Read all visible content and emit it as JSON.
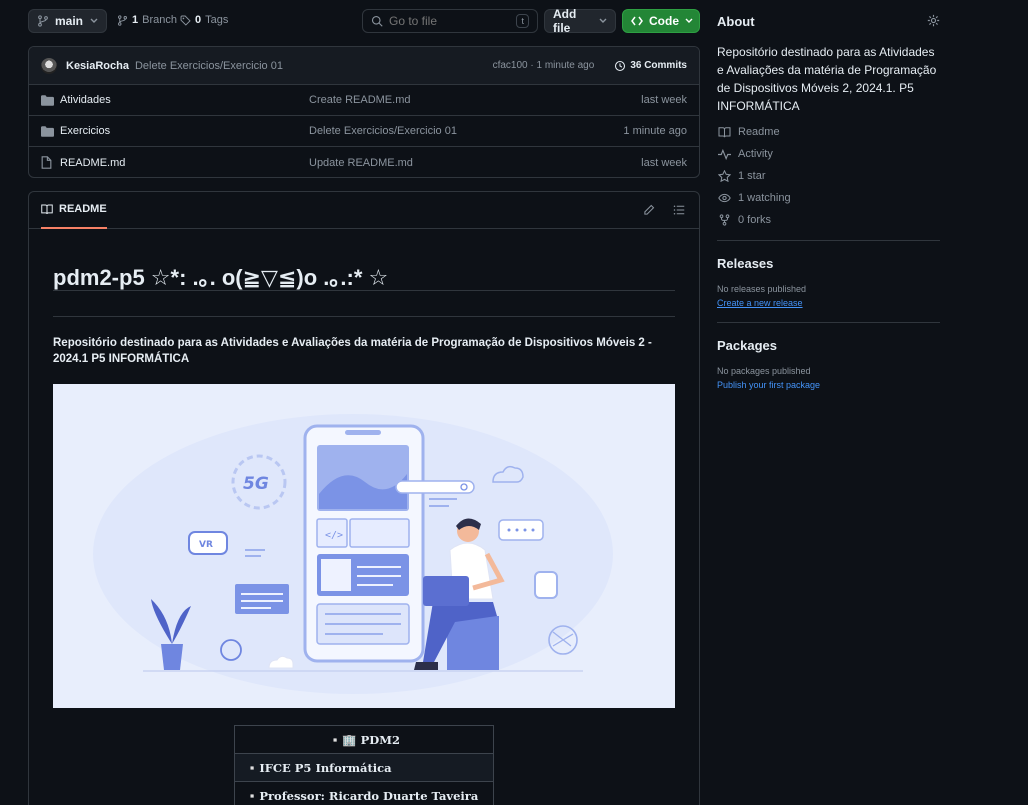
{
  "toolbar": {
    "branch": "main",
    "branch_count": "1",
    "branch_label": "Branch",
    "tag_count": "0",
    "tag_label": "Tags",
    "search_placeholder": "Go to file",
    "search_kbd": "t",
    "add_file": "Add file",
    "code": "Code"
  },
  "latest_commit": {
    "author": "KesiaRocha",
    "message": "Delete Exercicios/Exercicio 01",
    "hash_time": "cfac100 · 1 minute ago",
    "commits": "36 Commits"
  },
  "files": [
    {
      "name": "Atividades",
      "type": "folder",
      "message": "Create README.md",
      "date": "last week"
    },
    {
      "name": "Exercicios",
      "type": "folder",
      "message": "Delete Exercicios/Exercicio 01",
      "date": "1 minute ago"
    },
    {
      "name": "README.md",
      "type": "file",
      "message": "Update README.md",
      "date": "last week"
    }
  ],
  "readme": {
    "tab": "README",
    "title": "pdm2-p5 ☆*: .｡. o(≧▽≦)o .｡.:* ☆",
    "description": "Repositório destinado para as Atividades e Avaliações da matéria de Programação de Dispositivos Móveis 2 - 2024.1 P5 INFORMÁTICA",
    "banner_badge": "5G",
    "banner_vr": "VR",
    "table": {
      "header": "▫️🏢 PDM2",
      "rows": [
        "▫️IFCE P5 Informática",
        "▫️Professor: Ricardo Duarte Taveira"
      ]
    }
  },
  "about": {
    "title": "About",
    "description": "Repositório destinado para as Atividades e Avaliações da matéria de Programação de Dispositivos Móveis 2, 2024.1. P5 INFORMÁTICA",
    "readme": "Readme",
    "activity": "Activity",
    "stars": "1 star",
    "watching": "1 watching",
    "forks": "0 forks"
  },
  "releases": {
    "title": "Releases",
    "empty": "No releases published",
    "link": "Create a new release"
  },
  "packages": {
    "title": "Packages",
    "empty": "No packages published",
    "link": "Publish your first package"
  },
  "colors": {
    "accent": "#4493f8",
    "green": "#238636",
    "background": "#0d1117",
    "border": "#30363d",
    "tab_underline": "#f78166"
  }
}
